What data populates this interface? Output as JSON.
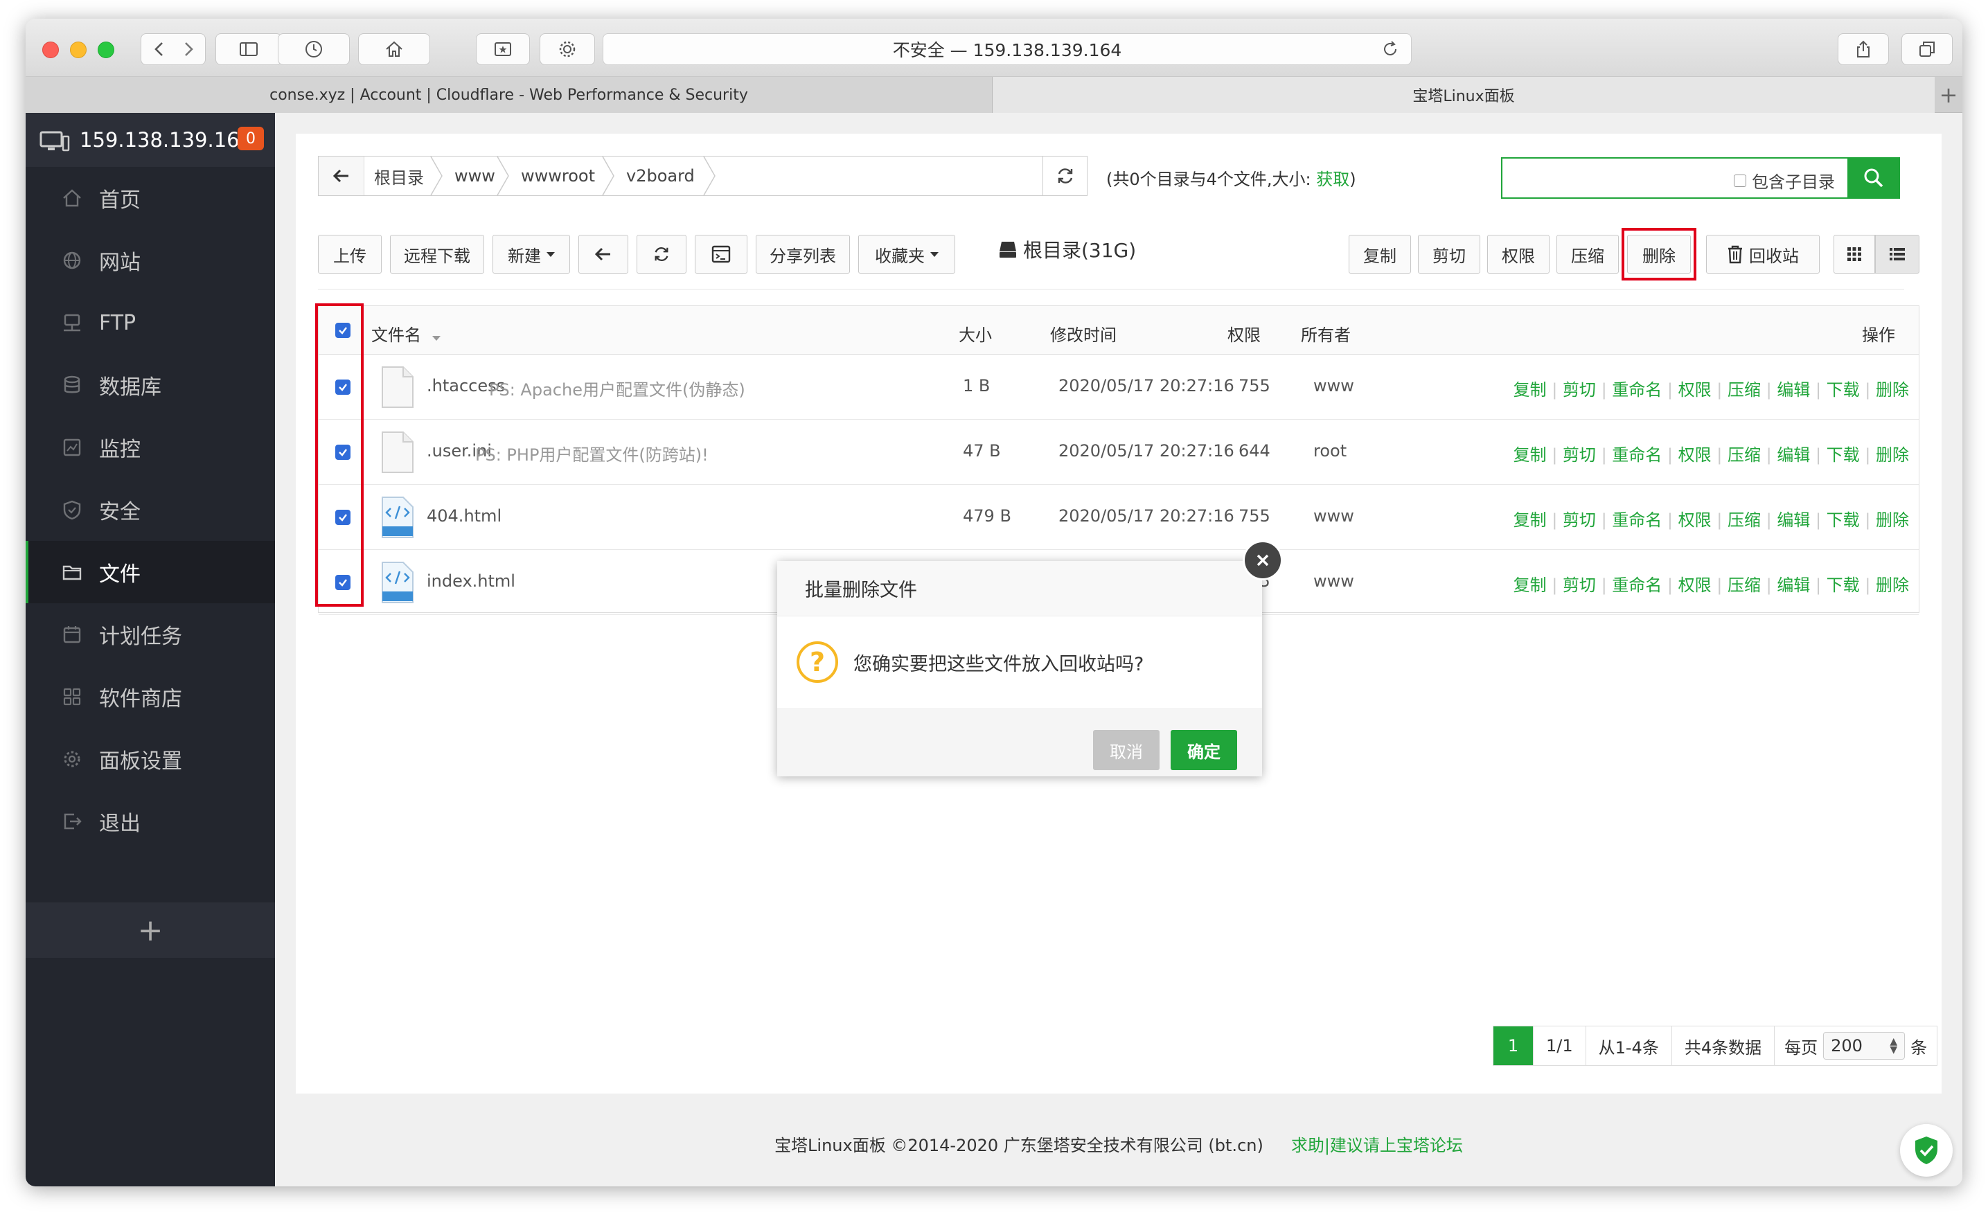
{
  "browser": {
    "url": "不安全 — 159.138.139.164",
    "tabs": [
      {
        "label": "conse.xyz | Account | Cloudflare - Web Performance & Security"
      },
      {
        "label": "宝塔Linux面板"
      }
    ]
  },
  "sidebar": {
    "server_ip": "159.138.139.164",
    "badge": "0",
    "items": [
      {
        "label": "首页",
        "icon": "home-icon"
      },
      {
        "label": "网站",
        "icon": "globe-icon"
      },
      {
        "label": "FTP",
        "icon": "ftp-icon"
      },
      {
        "label": "数据库",
        "icon": "database-icon"
      },
      {
        "label": "监控",
        "icon": "monitor-icon"
      },
      {
        "label": "安全",
        "icon": "shield-icon"
      },
      {
        "label": "文件",
        "icon": "folder-icon",
        "active": true
      },
      {
        "label": "计划任务",
        "icon": "calendar-icon"
      },
      {
        "label": "软件商店",
        "icon": "apps-icon"
      },
      {
        "label": "面板设置",
        "icon": "gear-icon"
      },
      {
        "label": "退出",
        "icon": "logout-icon"
      }
    ],
    "add": "+"
  },
  "files": {
    "breadcrumbs": [
      "根目录",
      "www",
      "wwwroot",
      "v2board"
    ],
    "dir_info_prefix": "(共0个目录与4个文件,大小: ",
    "dir_info_fetch": "获取",
    "dir_info_suffix": ")",
    "search_placeholder": "",
    "search_subdir": "包含子目录",
    "toolbar": {
      "upload": "上传",
      "remote_download": "远程下载",
      "new": "新建",
      "share_list": "分享列表",
      "favorites": "收藏夹",
      "disk": "根目录(31G)",
      "copy": "复制",
      "cut": "剪切",
      "permission": "权限",
      "compress": "压缩",
      "delete": "删除",
      "recycle": "回收站"
    },
    "columns": {
      "name": "文件名",
      "size": "大小",
      "mtime": "修改时间",
      "perm": "权限",
      "owner": "所有者",
      "ops": "操作"
    },
    "rows": [
      {
        "name": ".htaccess",
        "ps": "PS: Apache用户配置文件(伪静态)",
        "size": "1 B",
        "mtime": "2020/05/17 20:27:16",
        "perm": "755",
        "owner": "www",
        "type": "file"
      },
      {
        "name": ".user.ini",
        "ps": "PS: PHP用户配置文件(防跨站)!",
        "size": "47 B",
        "mtime": "2020/05/17 20:27:16",
        "perm": "644",
        "owner": "root",
        "type": "file"
      },
      {
        "name": "404.html",
        "ps": "",
        "size": "479 B",
        "mtime": "2020/05/17 20:27:16",
        "perm": "755",
        "owner": "www",
        "type": "html"
      },
      {
        "name": "index.html",
        "ps": "",
        "size": "",
        "mtime": "",
        "perm": "755",
        "owner": "www",
        "type": "html"
      }
    ],
    "row_ops": [
      "复制",
      "剪切",
      "重命名",
      "权限",
      "压缩",
      "编辑",
      "下载",
      "删除"
    ],
    "pager": {
      "current": "1",
      "pages": "1/1",
      "range": "从1-4条",
      "total": "共4条数据",
      "per_page_label": "每页",
      "per_page": "200",
      "unit": "条"
    }
  },
  "footer": {
    "copyright": "宝塔Linux面板 ©2014-2020 广东堡塔安全技术有限公司 (bt.cn)",
    "help": "求助|建议请上宝塔论坛"
  },
  "modal": {
    "title": "批量删除文件",
    "message": "您确实要把这些文件放入回收站吗?",
    "cancel": "取消",
    "ok": "确定"
  },
  "colors": {
    "accent": "#20a53a",
    "sidebar_bg": "#23262e",
    "highlight": "#e0001a",
    "checkbox": "#2f6bd9"
  }
}
